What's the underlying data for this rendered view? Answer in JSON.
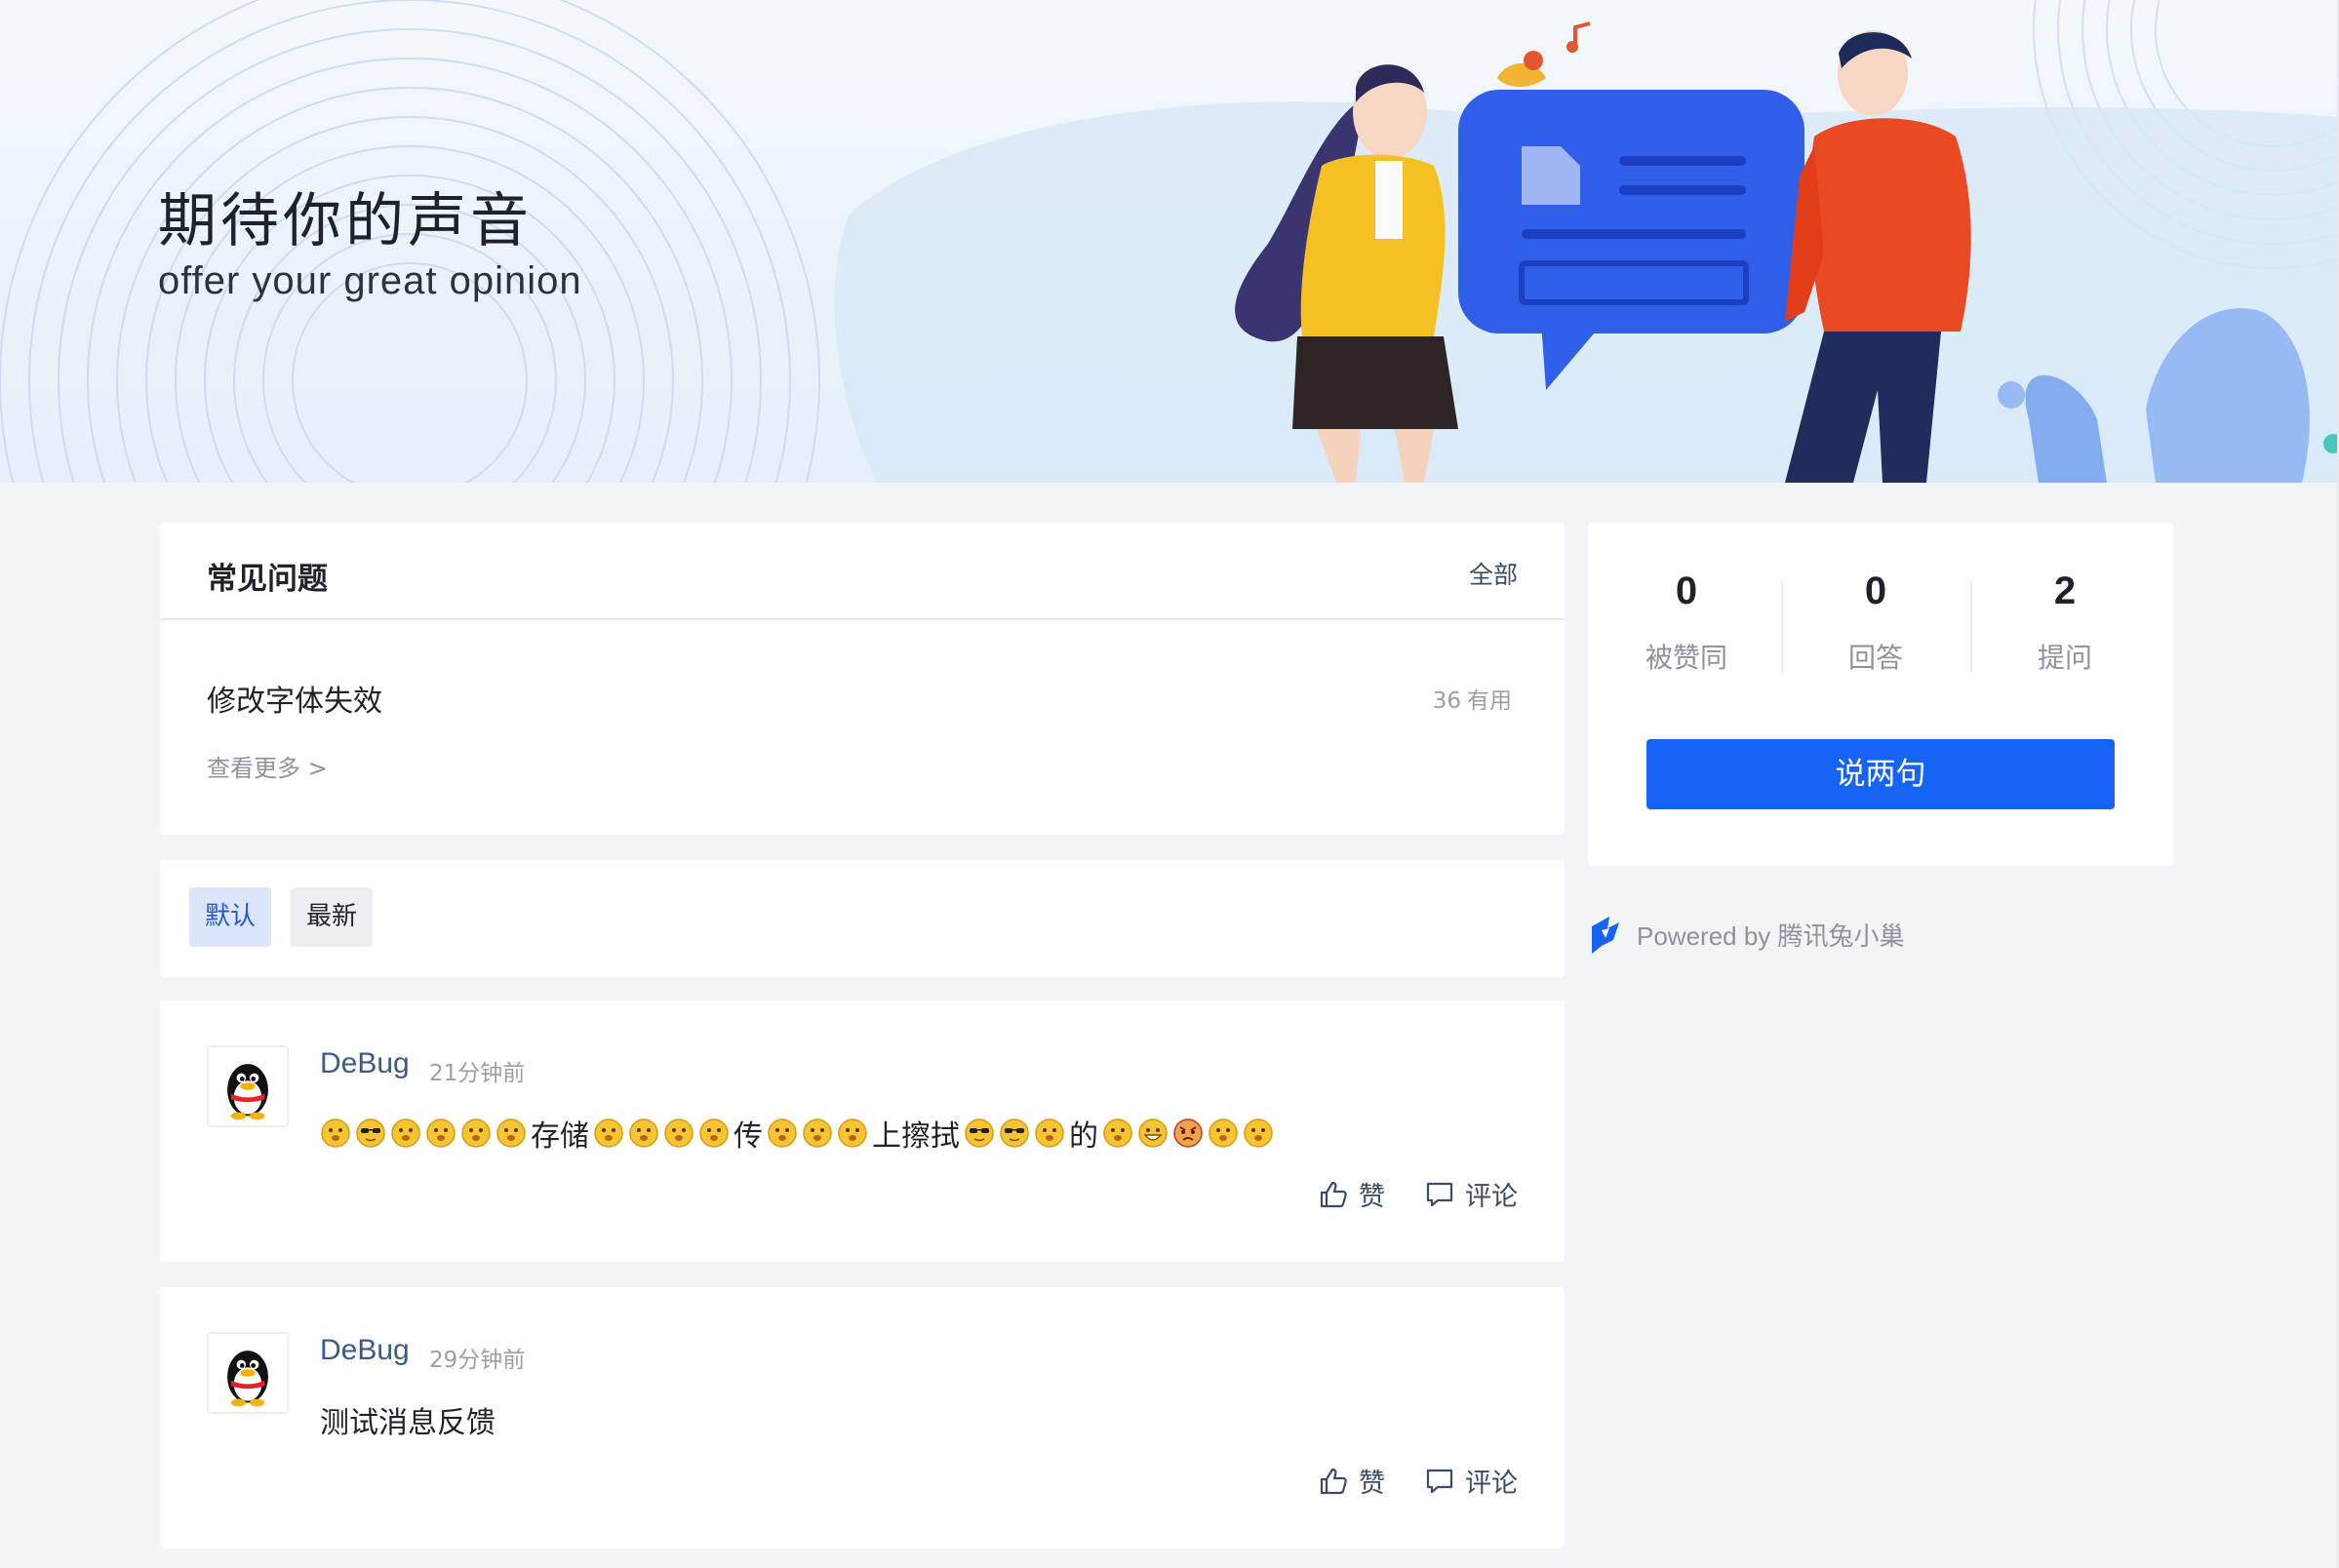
{
  "banner": {
    "title": "期待你的声音",
    "subtitle": "offer your great opinion"
  },
  "faq": {
    "title": "常见问题",
    "all_link": "全部",
    "items": [
      {
        "question": "修改字体失效",
        "useful_count": "36",
        "useful_label": "有用"
      }
    ],
    "more_link": "查看更多 >"
  },
  "sort": {
    "default_label": "默认",
    "newest_label": "最新",
    "active": "默认"
  },
  "posts": [
    {
      "author": "DeBug",
      "time": "21分钟前",
      "content_segments": [
        {
          "emoji": [
            "face",
            "cool",
            "face",
            "face",
            "face",
            "face"
          ]
        },
        {
          "text": "存储"
        },
        {
          "emoji": [
            "face",
            "face",
            "face",
            "face"
          ]
        },
        {
          "text": "传"
        },
        {
          "emoji": [
            "face",
            "face",
            "face"
          ]
        },
        {
          "text": " 上擦拭"
        },
        {
          "emoji": [
            "cool",
            "cool",
            "face"
          ]
        },
        {
          "text": "的"
        },
        {
          "emoji": [
            "face",
            "grin",
            "angry",
            "face",
            "face"
          ]
        }
      ],
      "like_label": "赞",
      "comment_label": "评论"
    },
    {
      "author": "DeBug",
      "time": "29分钟前",
      "content": "测试消息反馈",
      "like_label": "赞",
      "comment_label": "评论"
    }
  ],
  "stats": {
    "liked": {
      "value": "0",
      "label": "被赞同"
    },
    "answers": {
      "value": "0",
      "label": "回答"
    },
    "questions": {
      "value": "2",
      "label": "提问"
    }
  },
  "say_button": "说两句",
  "powered_by": "Powered by 腾讯兔小巢",
  "colors": {
    "accent": "#1763f5",
    "page_bg": "#f3f4f6",
    "author": "#3c5b86",
    "sort_active_bg": "#dbe6fb"
  },
  "icons": {
    "like": "thumbs-up-icon",
    "comment": "comment-icon",
    "brand": "txc-logo-icon",
    "avatar": "qq-penguin-avatar"
  }
}
